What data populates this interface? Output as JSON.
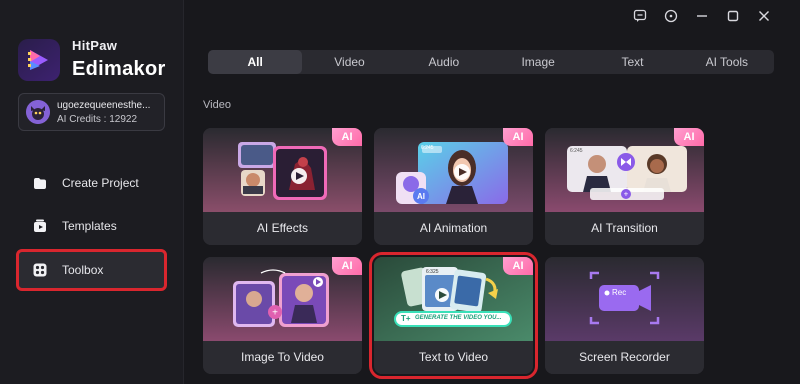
{
  "brand": {
    "top": "HitPaw",
    "name": "Edimakor"
  },
  "user": {
    "name": "ugoezequeenesthe...",
    "credits": "AI Credits : 12922"
  },
  "nav": [
    {
      "label": "Create Project",
      "icon": "folder-icon"
    },
    {
      "label": "Templates",
      "icon": "templates-icon"
    },
    {
      "label": "Toolbox",
      "icon": "toolbox-icon",
      "active": true
    }
  ],
  "window_icons": [
    "feedback-icon",
    "info-icon",
    "minimize-icon",
    "maximize-icon",
    "close-icon"
  ],
  "tabs": [
    {
      "label": "All",
      "active": true
    },
    {
      "label": "Video"
    },
    {
      "label": "Audio"
    },
    {
      "label": "Image"
    },
    {
      "label": "Text"
    },
    {
      "label": "AI Tools"
    }
  ],
  "section": "Video",
  "cards": [
    {
      "label": "AI Effects",
      "badge": "AI"
    },
    {
      "label": "AI Animation",
      "badge": "AI",
      "thumb_text": "6:245"
    },
    {
      "label": "AI Transition",
      "badge": "AI",
      "thumb_text": "6:245"
    },
    {
      "label": "Image To Video",
      "badge": "AI"
    },
    {
      "label": "Text to Video",
      "badge": "AI",
      "highlighted": true,
      "thumb_text": "6:325",
      "prompt_text": "GENERATE THE VIDEO YOU..."
    },
    {
      "label": "Screen Recorder",
      "thumb_text": "Rec"
    }
  ],
  "colors": {
    "accent_red": "#d9262e",
    "ai_badge": "#ff6aa8",
    "brand_purple": "#7b3cf0"
  }
}
